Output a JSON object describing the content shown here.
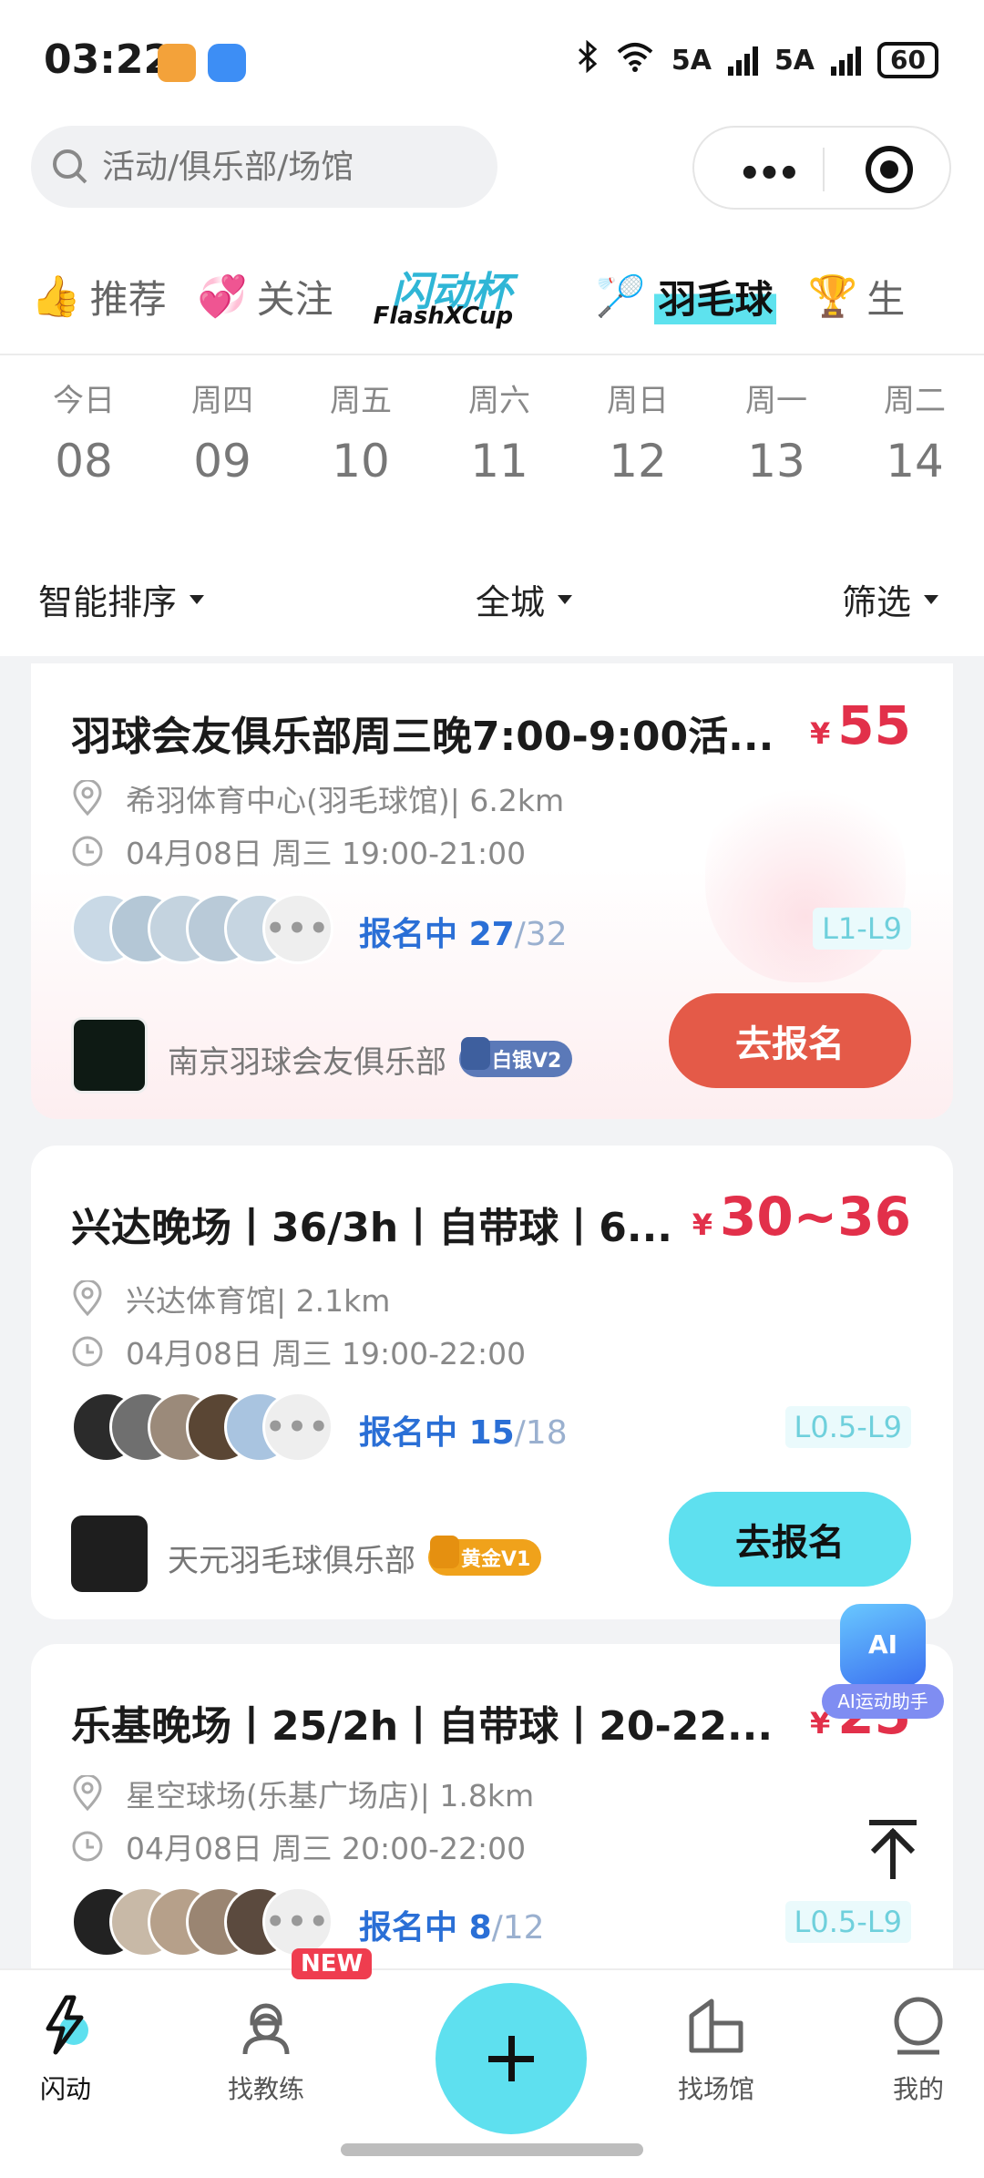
{
  "status_bar": {
    "time": "03:22",
    "network1": "5A",
    "network2": "5A",
    "battery": "60"
  },
  "search": {
    "placeholder": "活动/俱乐部/场馆"
  },
  "tabs": [
    {
      "label": "推荐",
      "icon": "thumbs-up-icon"
    },
    {
      "label": "关注",
      "icon": "hearts-icon"
    },
    {
      "label": "闪动杯",
      "sub": "FlashXCup",
      "icon": "flash-cup-logo"
    },
    {
      "label": "羽毛球",
      "icon": "racket-icon",
      "active": true
    },
    {
      "label": "生",
      "icon": "trophy-icon"
    }
  ],
  "dates": [
    {
      "weekday": "今日",
      "day": "08"
    },
    {
      "weekday": "周四",
      "day": "09"
    },
    {
      "weekday": "周五",
      "day": "10"
    },
    {
      "weekday": "周六",
      "day": "11"
    },
    {
      "weekday": "周日",
      "day": "12"
    },
    {
      "weekday": "周一",
      "day": "13"
    },
    {
      "weekday": "周二",
      "day": "14"
    }
  ],
  "filters": {
    "sort": "智能排序",
    "area": "全城",
    "filter": "筛选"
  },
  "events": [
    {
      "title": "羽球会友俱乐部周三晚7:00-9:00活...",
      "currency": "¥",
      "price": "55",
      "venue": "希羽体育中心(羽毛球馆)| 6.2km",
      "time": "04月08日 周三 19:00-21:00",
      "status": "报名中",
      "joined": "27",
      "capacity": "/32",
      "level": "L1-L9",
      "club": "南京羽球会友俱乐部",
      "badge": "白银V2",
      "button": "去报名",
      "accent": "#e45a48"
    },
    {
      "title": "兴达晚场丨36/3h丨自带球丨6...",
      "currency": "¥",
      "price": "30~36",
      "venue": "兴达体育馆| 2.1km",
      "time": "04月08日 周三 19:00-22:00",
      "status": "报名中",
      "joined": "15",
      "capacity": "/18",
      "level": "L0.5-L9",
      "club": "天元羽毛球俱乐部",
      "badge": "黄金V1",
      "button": "去报名",
      "accent": "#5ee0ef"
    },
    {
      "title": "乐基晚场丨25/2h丨自带球丨20-22...",
      "currency": "¥",
      "price": "25",
      "venue": "星空球场(乐基广场店)| 1.8km",
      "time": "04月08日 周三 20:00-22:00",
      "status": "报名中",
      "joined": "8",
      "capacity": "/12",
      "level": "L0.5-L9"
    }
  ],
  "more_dots": "•••",
  "ai_helper": {
    "icon_text": "AI",
    "label": "AI运动助手"
  },
  "bottom_nav": [
    {
      "label": "闪动",
      "icon": "flash-icon",
      "active": true
    },
    {
      "label": "找教练",
      "icon": "coach-icon",
      "tag": "NEW"
    },
    {
      "label": "",
      "icon": "plus-icon"
    },
    {
      "label": "找场馆",
      "icon": "venue-icon"
    },
    {
      "label": "我的",
      "icon": "profile-icon"
    }
  ],
  "colors": {
    "accent_cyan": "#5ee0ef",
    "price_red": "#e2304a",
    "signup_blue": "#2a6fd6"
  }
}
